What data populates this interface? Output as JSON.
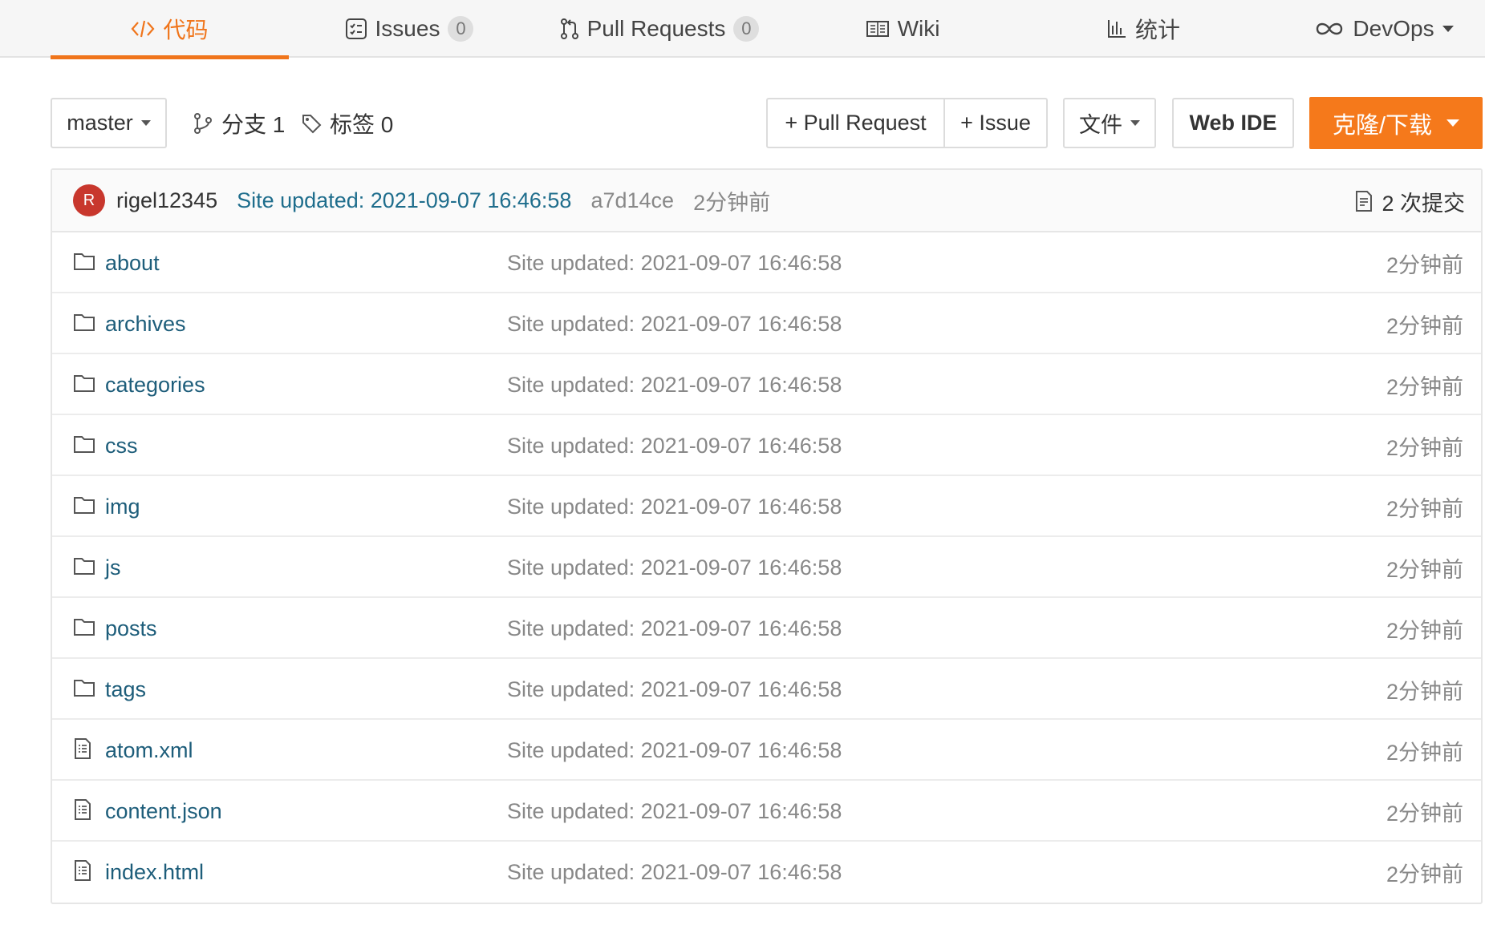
{
  "tabs": [
    {
      "label": "代码",
      "icon": "code-icon",
      "active": true
    },
    {
      "label": "Issues",
      "icon": "issues-icon",
      "count": "0"
    },
    {
      "label": "Pull Requests",
      "icon": "pull-request-icon",
      "count": "0"
    },
    {
      "label": "Wiki",
      "icon": "wiki-icon"
    },
    {
      "label": "统计",
      "icon": "stats-icon"
    },
    {
      "label": "DevOps",
      "icon": "infinity-icon",
      "dropdown": true
    }
  ],
  "toolbar": {
    "branch": "master",
    "branches_label": "分支 1",
    "tags_label": "标签 0",
    "pull_request_label": "+ Pull Request",
    "issue_label": "+ Issue",
    "file_label": "文件",
    "webide_label": "Web IDE",
    "clone_label": "克隆/下载"
  },
  "commit": {
    "avatar_letter": "R",
    "author": "rigel12345",
    "message": "Site updated: 2021-09-07 16:46:58",
    "sha": "a7d14ce",
    "time": "2分钟前",
    "count_label": "2 次提交"
  },
  "files": [
    {
      "name": "about",
      "type": "folder",
      "message": "Site updated: 2021-09-07 16:46:58",
      "time": "2分钟前"
    },
    {
      "name": "archives",
      "type": "folder",
      "message": "Site updated: 2021-09-07 16:46:58",
      "time": "2分钟前"
    },
    {
      "name": "categories",
      "type": "folder",
      "message": "Site updated: 2021-09-07 16:46:58",
      "time": "2分钟前"
    },
    {
      "name": "css",
      "type": "folder",
      "message": "Site updated: 2021-09-07 16:46:58",
      "time": "2分钟前"
    },
    {
      "name": "img",
      "type": "folder",
      "message": "Site updated: 2021-09-07 16:46:58",
      "time": "2分钟前"
    },
    {
      "name": "js",
      "type": "folder",
      "message": "Site updated: 2021-09-07 16:46:58",
      "time": "2分钟前"
    },
    {
      "name": "posts",
      "type": "folder",
      "message": "Site updated: 2021-09-07 16:46:58",
      "time": "2分钟前"
    },
    {
      "name": "tags",
      "type": "folder",
      "message": "Site updated: 2021-09-07 16:46:58",
      "time": "2分钟前"
    },
    {
      "name": "atom.xml",
      "type": "file",
      "message": "Site updated: 2021-09-07 16:46:58",
      "time": "2分钟前"
    },
    {
      "name": "content.json",
      "type": "file",
      "message": "Site updated: 2021-09-07 16:46:58",
      "time": "2分钟前"
    },
    {
      "name": "index.html",
      "type": "file",
      "message": "Site updated: 2021-09-07 16:46:58",
      "time": "2分钟前"
    }
  ],
  "colors": {
    "accent": "#f5791b",
    "link": "#1d5d7a",
    "avatar": "#c8372d"
  }
}
